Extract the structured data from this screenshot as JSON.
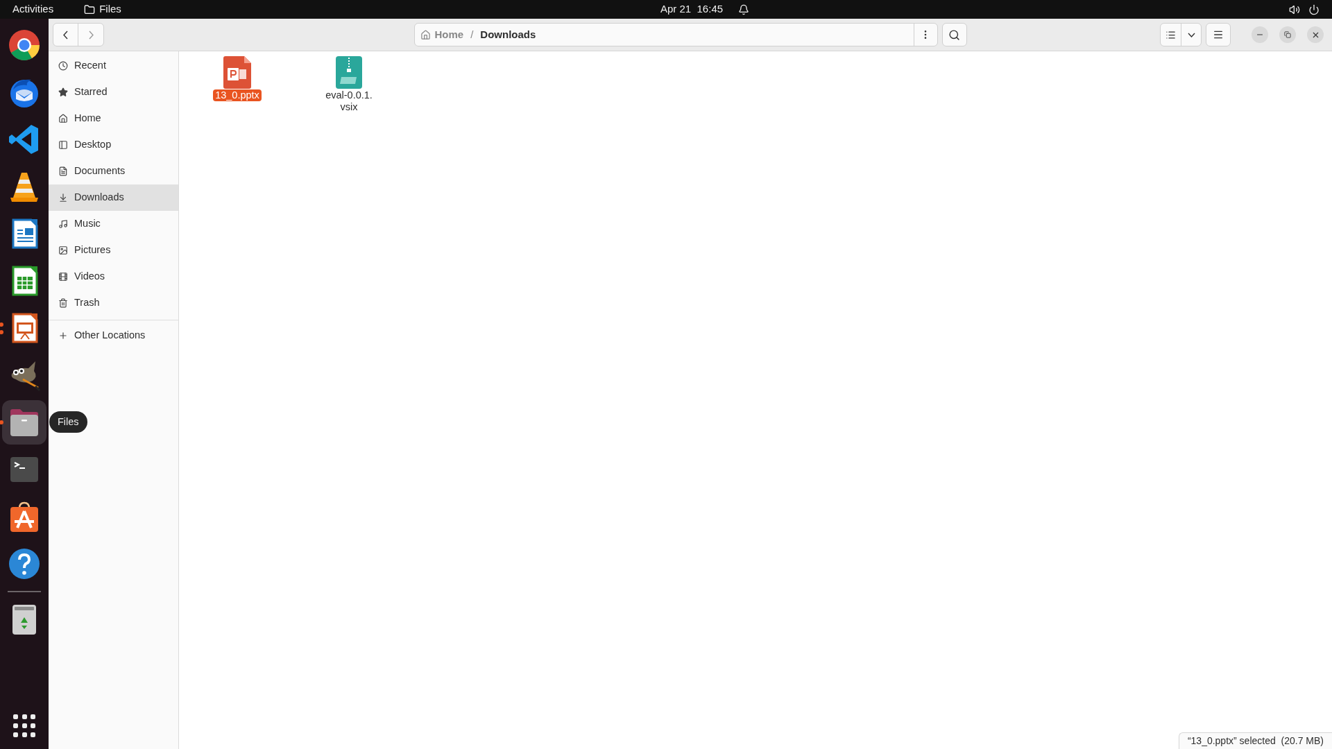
{
  "top_bar": {
    "activities": "Activities",
    "app_name": "Files",
    "clock": "Apr 21  16:45"
  },
  "dock": {
    "items": [
      {
        "kind": "chrome",
        "selected": false,
        "running": false,
        "multiple_windows": false
      },
      {
        "kind": "thunderbird",
        "selected": false,
        "running": false,
        "multiple_windows": false
      },
      {
        "kind": "vscode",
        "selected": false,
        "running": false,
        "multiple_windows": false
      },
      {
        "kind": "vlc",
        "selected": false,
        "running": false,
        "multiple_windows": false
      },
      {
        "kind": "writer",
        "selected": false,
        "running": false,
        "multiple_windows": false
      },
      {
        "kind": "calc",
        "selected": false,
        "running": false,
        "multiple_windows": false
      },
      {
        "kind": "impress",
        "selected": false,
        "running": true,
        "multiple_windows": true
      },
      {
        "kind": "gimp",
        "selected": false,
        "running": false,
        "multiple_windows": false
      },
      {
        "kind": "files",
        "selected": true,
        "running": true,
        "multiple_windows": false
      },
      {
        "kind": "terminal",
        "selected": false,
        "running": false,
        "multiple_windows": false
      },
      {
        "kind": "software",
        "selected": false,
        "running": false,
        "multiple_windows": false
      },
      {
        "kind": "help",
        "selected": false,
        "running": false,
        "multiple_windows": false
      },
      {
        "kind": "separator"
      },
      {
        "kind": "trash",
        "selected": false,
        "running": false,
        "multiple_windows": false
      }
    ],
    "tooltip": "Files"
  },
  "path_bar": {
    "separator": "/",
    "crumbs": [
      {
        "label": "Home",
        "kind": "home",
        "selected": false
      },
      {
        "label": "Downloads",
        "kind": "folder",
        "selected": true
      }
    ]
  },
  "sidebar": {
    "places": [
      {
        "label": "Recent",
        "kind": "recent",
        "selected": false
      },
      {
        "label": "Starred",
        "kind": "starred",
        "selected": false
      },
      {
        "label": "Home",
        "kind": "home",
        "selected": false
      },
      {
        "label": "Desktop",
        "kind": "desktop",
        "selected": false
      },
      {
        "label": "Documents",
        "kind": "documents",
        "selected": false
      },
      {
        "label": "Downloads",
        "kind": "downloads",
        "selected": true
      },
      {
        "label": "Music",
        "kind": "music",
        "selected": false
      },
      {
        "label": "Pictures",
        "kind": "pictures",
        "selected": false
      },
      {
        "label": "Videos",
        "kind": "videos",
        "selected": false
      },
      {
        "label": "Trash",
        "kind": "trash",
        "selected": false
      }
    ],
    "other": [
      {
        "label": "Other Locations",
        "kind": "other",
        "selected": false
      }
    ]
  },
  "files": [
    {
      "name": "13_0.pptx",
      "kind": "presentation",
      "selected": true
    },
    {
      "name": "eval-0.0.1.vsix",
      "kind": "archive",
      "selected": false
    }
  ],
  "status_bar": "“13_0.pptx” selected  (20.7 MB)"
}
